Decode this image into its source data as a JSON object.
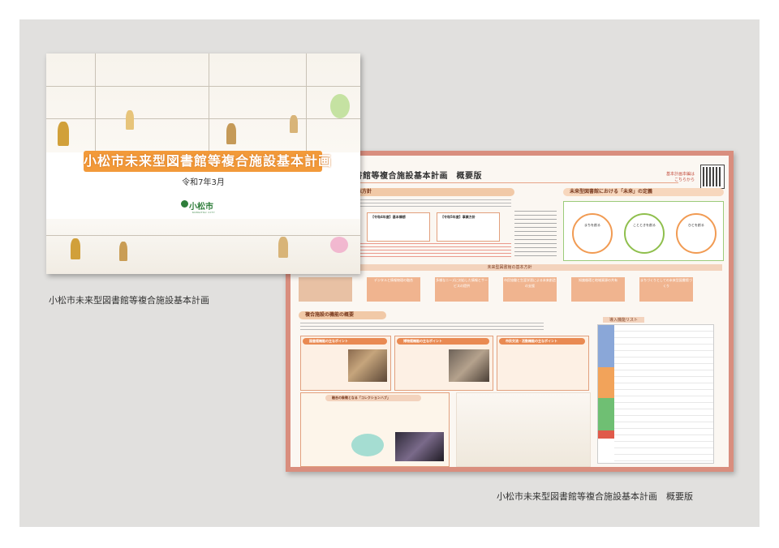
{
  "cover": {
    "title": "小松市未来型図書館等複合施設基本計画",
    "date": "令和7年3月",
    "logo_text": "小松市",
    "logo_sub": "KOMATSU CITY"
  },
  "summary": {
    "title": "図書館等複合施設基本計画　概要版",
    "qr_caption": "基本計画本編は\nこちらから",
    "sec1": "基本方針",
    "box_a": "【令和4年度】基本構想",
    "box_b": "【令和5年度】事業方針",
    "future_header": "未来型図書館における「未来」の定義",
    "circles": [
      "まちを創る",
      "ことときを創る",
      "ひとを創る"
    ],
    "policy_bar": "未来型図書館の基本方針",
    "policies": [
      "デジタルと情報物理の融合",
      "多様なニーズに対応した情報とサービスの提供",
      "市民協働と生涯学習による未来創造の支援",
      "知識循環と地域資源の共有",
      "まちづくりとしての未来型図書館づくり"
    ],
    "sec2": "複合施設の機能の概要",
    "func_a": "図書館機能の主なポイント",
    "func_b": "博物館機能の主なポイント",
    "func_c": "市民交流・活動機能の主なポイント",
    "hub": "融合の象徴となる「コレクションハブ」",
    "table_title": "導入機能リスト"
  },
  "captions": {
    "cover_caption": "小松市未来型図書館等複合施設基本計画",
    "summary_caption": "小松市未来型図書館等複合施設基本計画　概要版"
  }
}
